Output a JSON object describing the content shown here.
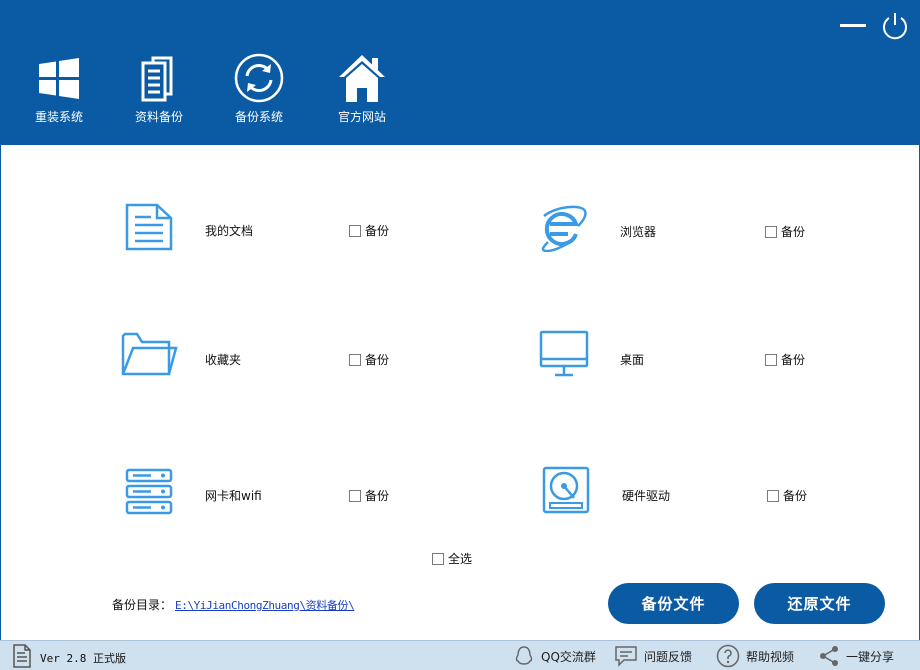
{
  "header": {
    "nav": [
      {
        "label": "重装系统"
      },
      {
        "label": "资料备份"
      },
      {
        "label": "备份系统"
      },
      {
        "label": "官方网站"
      }
    ]
  },
  "items": [
    {
      "label": "我的文档",
      "check_label": "备份",
      "icon": "document-icon"
    },
    {
      "label": "浏览器",
      "check_label": "备份",
      "icon": "ie-browser-icon"
    },
    {
      "label": "收藏夹",
      "check_label": "备份",
      "icon": "folder-icon"
    },
    {
      "label": "桌面",
      "check_label": "备份",
      "icon": "monitor-icon"
    },
    {
      "label": "网卡和wifi",
      "check_label": "备份",
      "icon": "server-icon"
    },
    {
      "label": "硬件驱动",
      "check_label": "备份",
      "icon": "hard-drive-icon"
    }
  ],
  "select_all": "全选",
  "backup_dir": {
    "label": "备份目录：",
    "path": "E:\\YiJianChongZhuang\\资料备份\\"
  },
  "buttons": {
    "backup": "备份文件",
    "restore": "还原文件"
  },
  "footer": {
    "version": "Ver 2.8 正式版",
    "qq_group": "QQ交流群",
    "feedback": "问题反馈",
    "help_video": "帮助视频",
    "share": "一键分享"
  },
  "colors": {
    "brand": "#0a5aa4",
    "icon": "#3a9ae6",
    "footer_bg": "#cfe0ef"
  }
}
